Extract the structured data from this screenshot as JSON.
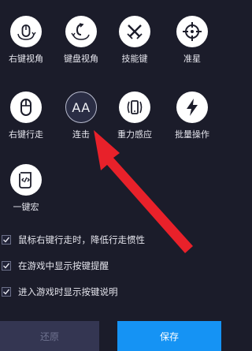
{
  "actions": [
    {
      "label": "右键视角",
      "icon": "mouse-right-rotate-icon"
    },
    {
      "label": "键盘视角",
      "icon": "keyboard-rotate-icon"
    },
    {
      "label": "技能键",
      "icon": "crossed-swords-icon"
    },
    {
      "label": "准星",
      "icon": "crosshair-icon"
    },
    {
      "label": "右键行走",
      "icon": "mouse-icon"
    },
    {
      "label": "连击",
      "icon": "aa-combo-icon",
      "icon_text": "AA",
      "selected": true
    },
    {
      "label": "重力感应",
      "icon": "phone-rotate-icon"
    },
    {
      "label": "批量操作",
      "icon": "lightning-icon"
    },
    {
      "label": "一键宏",
      "icon": "macro-scroll-icon"
    }
  ],
  "options": [
    {
      "label": "鼠标右键行走时，降低行走惯性",
      "checked": true
    },
    {
      "label": "在游戏中显示按键提醒",
      "checked": true
    },
    {
      "label": "进入游戏时显示按键说明",
      "checked": true
    }
  ],
  "buttons": {
    "restore": "还原",
    "save": "保存"
  },
  "colors": {
    "background": "#1b1c2a",
    "accent": "#1593f4",
    "arrow": "#e8212a",
    "disabled": "#343652"
  }
}
